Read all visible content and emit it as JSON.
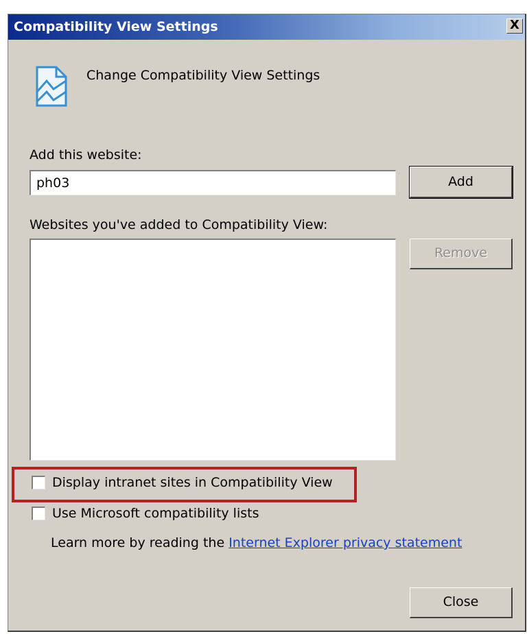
{
  "window": {
    "title": "Compatibility View Settings",
    "close_glyph": "X"
  },
  "header": {
    "icon": "compatibility-view-icon",
    "text": "Change Compatibility View Settings"
  },
  "add_section": {
    "label": "Add this website:",
    "input_value": "ph03",
    "add_button": "Add"
  },
  "list_section": {
    "label": "Websites you've added to Compatibility View:",
    "items": [],
    "remove_button": "Remove",
    "remove_enabled": false
  },
  "options": [
    {
      "label": "Display intranet sites in Compatibility View",
      "checked": false,
      "highlighted": true
    },
    {
      "label": "Use Microsoft compatibility lists",
      "checked": false,
      "highlighted": false
    }
  ],
  "privacy": {
    "prefix": "Learn more by reading the",
    "link_text": "Internet Explorer privacy statement"
  },
  "footer": {
    "close_button": "Close"
  },
  "colors": {
    "dialog_bg": "#d4d0c8",
    "title_start": "#0b2a8c",
    "title_end": "#b6cdeb",
    "highlight": "#b22222",
    "link": "#1a3fbf"
  }
}
